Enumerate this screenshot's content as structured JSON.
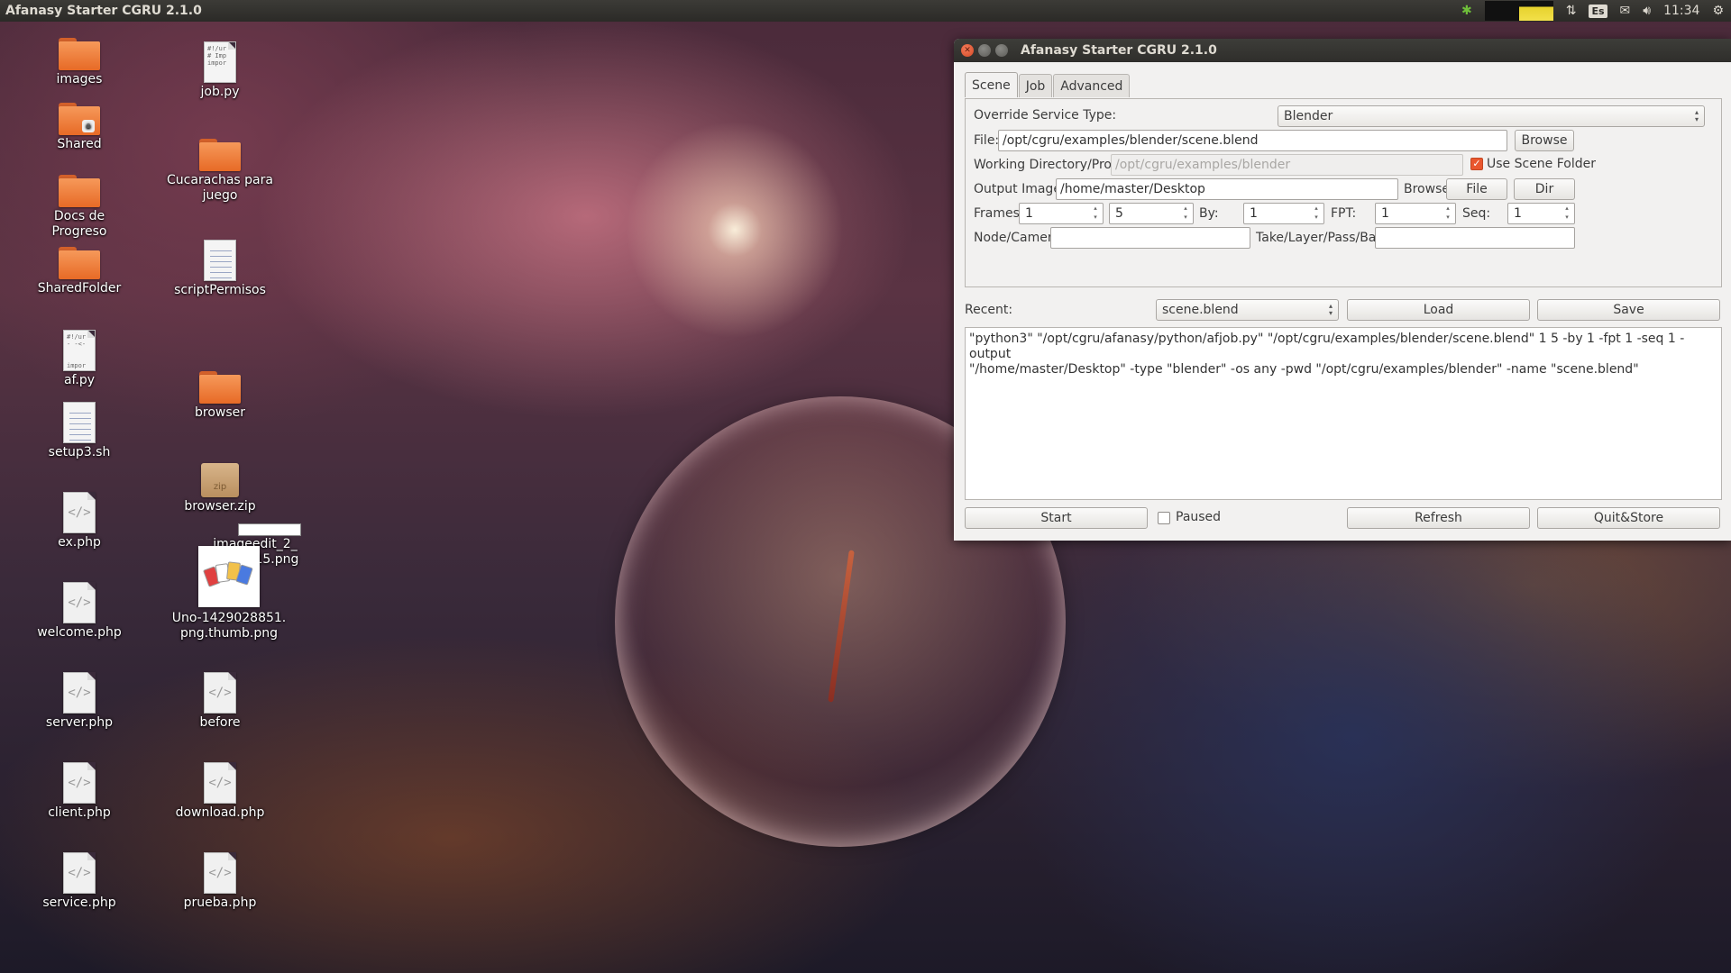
{
  "top_panel": {
    "app_title": "Afanasy Starter   CGRU 2.1.0",
    "keyboard": "Es",
    "clock": "11:34"
  },
  "desktop": {
    "icons": [
      {
        "label": "images",
        "type": "folder"
      },
      {
        "label": "Shared",
        "type": "folder-shared"
      },
      {
        "label": "Docs de Progreso",
        "type": "folder"
      },
      {
        "label": "SharedFolder",
        "type": "folder"
      },
      {
        "label": "af.py",
        "type": "script"
      },
      {
        "label": "setup3.sh",
        "type": "text"
      },
      {
        "label": "ex.php",
        "type": "code"
      },
      {
        "label": "welcome.php",
        "type": "code"
      },
      {
        "label": "server.php",
        "type": "code"
      },
      {
        "label": "client.php",
        "type": "code"
      },
      {
        "label": "service.php",
        "type": "code"
      },
      {
        "label": "job.py",
        "type": "script"
      },
      {
        "label": "Cucarachas para juego",
        "type": "folder"
      },
      {
        "label": "scriptPermisos",
        "type": "text"
      },
      {
        "label": "browser",
        "type": "folder"
      },
      {
        "label": "browser.zip",
        "type": "zip"
      },
      {
        "label": "imageedit_2_",
        "type": "rename"
      },
      {
        "label": "Uno-1429028851.\npng.thumb.png",
        "type": "image"
      },
      {
        "label": "before",
        "type": "code"
      },
      {
        "label": "download.php",
        "type": "code"
      },
      {
        "label": "prueba.php",
        "type": "code"
      }
    ],
    "partial_label": "4515.png"
  },
  "window": {
    "title": "Afanasy Starter   CGRU 2.1.0",
    "tabs": [
      "Scene",
      "Job",
      "Advanced"
    ],
    "active_tab": "Scene",
    "override_label": "Override Service Type:",
    "override_value": "Blender",
    "file_label": "File:",
    "file_value": "/opt/cgru/examples/blender/scene.blend",
    "browse_label": "Browse",
    "workdir_label": "Working Directory/Project:",
    "workdir_value": "/opt/cgru/examples/blender",
    "use_scene_folder_label": "Use Scene Folder",
    "use_scene_folder_checked": true,
    "output_label": "Output Images:",
    "output_value": "/home/master/Desktop",
    "output_browse_label": "Browse",
    "file_button": "File",
    "dir_button": "Dir",
    "frames_label": "Frames:",
    "frame_start": "1",
    "frame_end": "5",
    "by_label": "By:",
    "by_value": "1",
    "fpt_label": "FPT:",
    "fpt_value": "1",
    "seq_label": "Seq:",
    "seq_value": "1",
    "node_label": "Node/Camera:",
    "node_value": "",
    "take_label": "Take/Layer/Pass/Batch:",
    "take_value": "",
    "recent_label": "Recent:",
    "recent_value": "scene.blend",
    "load_label": "Load",
    "save_label": "Save",
    "command_line1": "\"python3\" \"/opt/cgru/afanasy/python/afjob.py\" \"/opt/cgru/examples/blender/scene.blend\" 1 5 -by 1 -fpt 1 -seq 1 -output",
    "command_line2": "\"/home/master/Desktop\" -type \"blender\" -os any -pwd \"/opt/cgru/examples/blender\" -name \"scene.blend\"",
    "start_label": "Start",
    "paused_label": "Paused",
    "paused_checked": false,
    "refresh_label": "Refresh",
    "quit_label": "Quit&Store"
  }
}
